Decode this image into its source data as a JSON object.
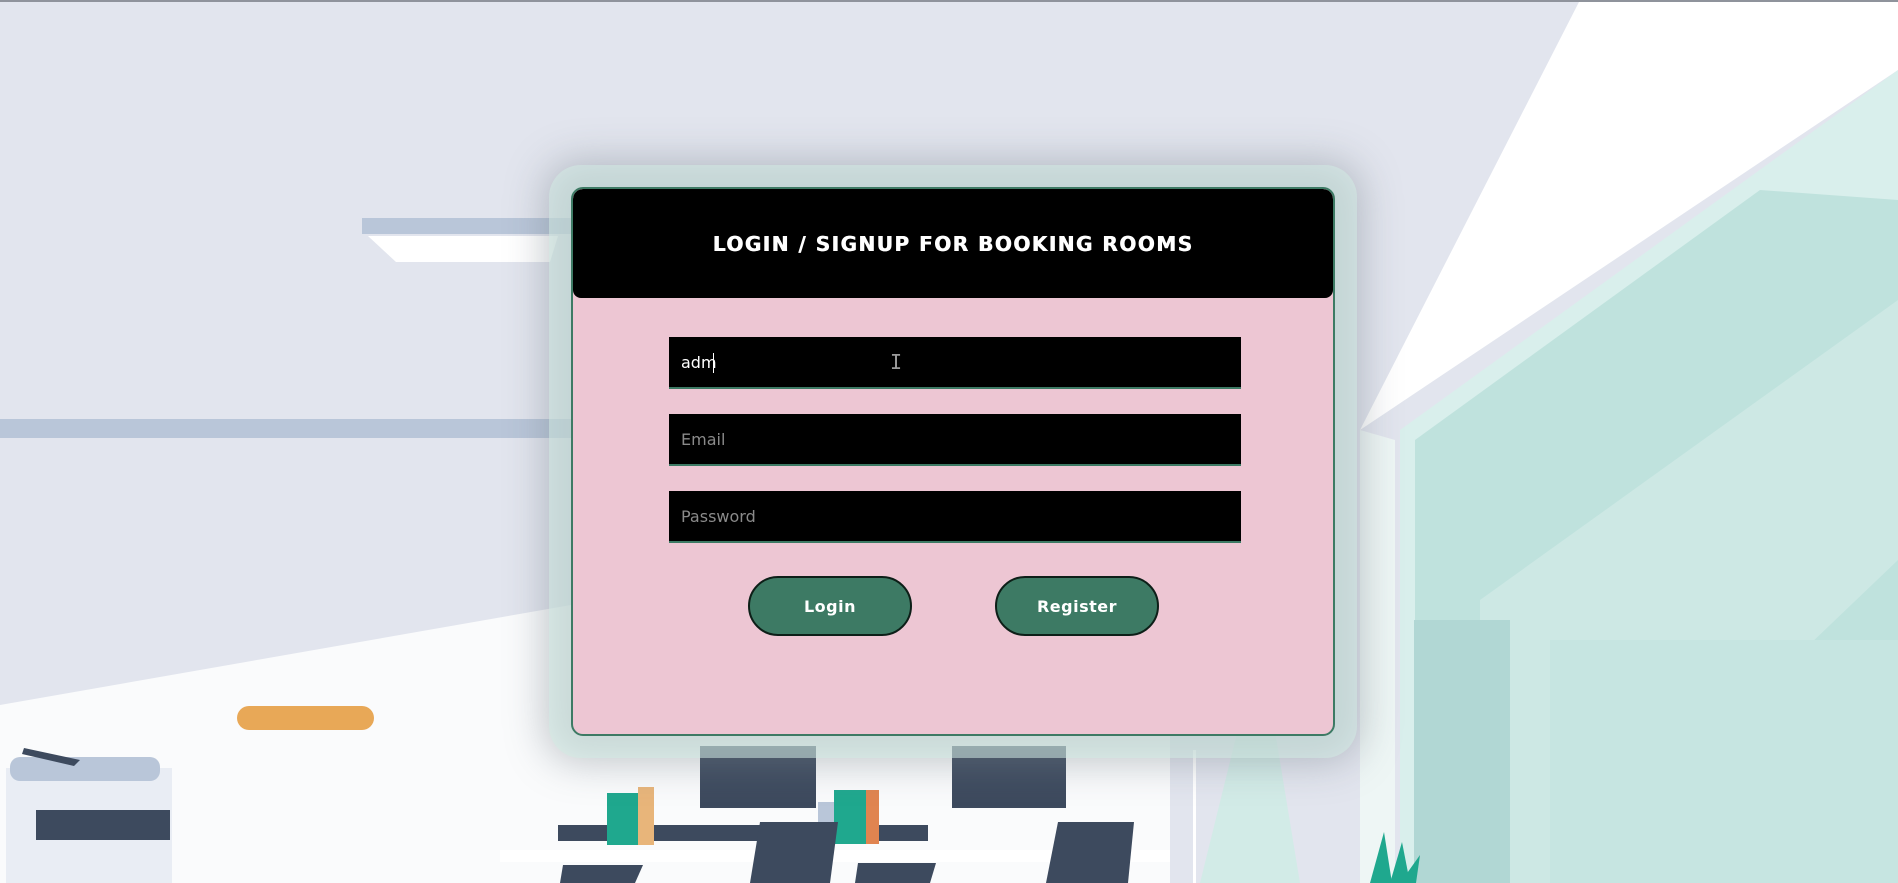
{
  "header": {
    "title": "LOGIN / SIGNUP FOR BOOKING ROOMS"
  },
  "form": {
    "name_value": "adm",
    "email_placeholder": "Email",
    "password_placeholder": "Password"
  },
  "buttons": {
    "login_label": "Login",
    "register_label": "Register"
  },
  "colors": {
    "card_background": "#edc6d3",
    "header_background": "#000000",
    "accent": "#3d7a64"
  }
}
